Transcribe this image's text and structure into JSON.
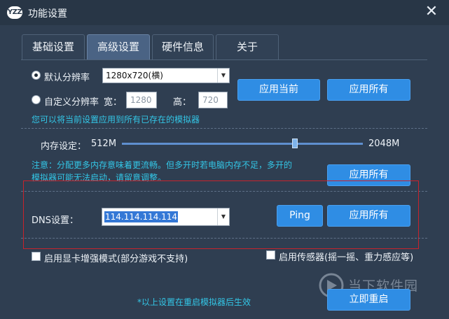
{
  "window": {
    "logo_text": "YZZ",
    "title": "功能设置",
    "close": "✕"
  },
  "tabs": [
    {
      "label": "基础设置",
      "active": false
    },
    {
      "label": "高级设置",
      "active": true
    },
    {
      "label": "硬件信息",
      "active": false
    },
    {
      "label": "关于",
      "active": false
    }
  ],
  "resolution": {
    "default_label": "默认分辨率",
    "default_value": "1280x720(横)",
    "default_checked": true,
    "custom_label": "自定义分辨率",
    "width_label": "宽：",
    "width_value": "1280",
    "height_label": "高：",
    "height_value": "720",
    "apply_current": "应用当前",
    "apply_all": "应用所有",
    "hint": "您可以将当前设置应用到所有已存在的模拟器"
  },
  "memory": {
    "label": "内存设定：",
    "min": "512M",
    "max": "2048M",
    "slider_level": 0.71,
    "note_line1": "注意：分配更多内存意味着更流畅。但多开时若电脑内存不足，多开的",
    "note_line2": "模拟器可能无法启动，请留意调整。",
    "apply_all": "应用所有"
  },
  "dns": {
    "label": "DNS设置：",
    "value": "114.114.114.114",
    "ping": "Ping",
    "apply_all": "应用所有"
  },
  "options": {
    "gpu_label": "启用显卡增强模式(部分游戏不支持)",
    "gpu_checked": false,
    "sensor_label": "启用传感器(摇一摇、重力感应等)",
    "sensor_checked": false
  },
  "footer": {
    "note": "*以上设置在重启模拟器后生效",
    "restart": "立即重启"
  },
  "watermark": {
    "text": "当下软件园"
  },
  "icons": {
    "dropdown": "chevron-down-icon",
    "close": "close-icon"
  },
  "colors": {
    "accent_button": "#2f8de4",
    "hint_text": "#33c6e6",
    "highlight_border": "#c8232c",
    "background": "#2f3e51"
  }
}
